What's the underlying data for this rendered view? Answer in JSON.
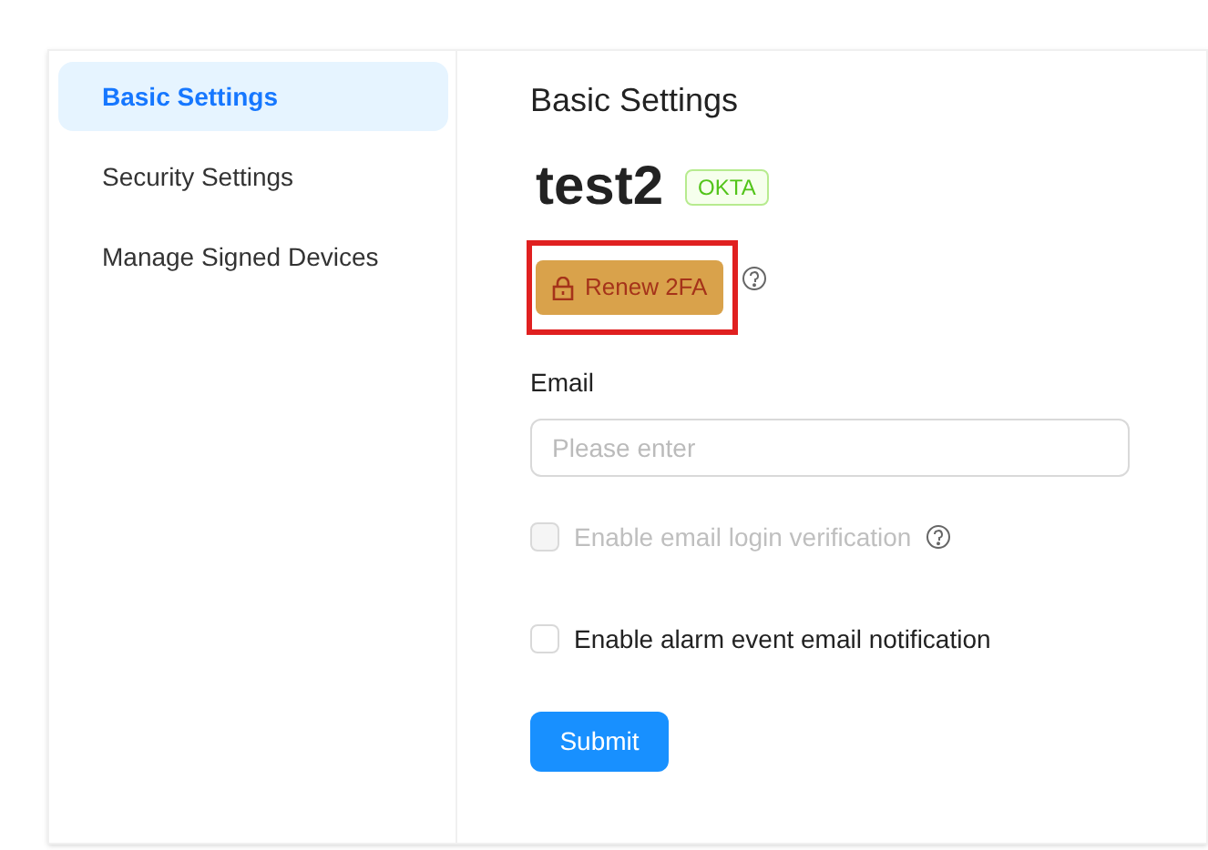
{
  "sidebar": {
    "items": [
      {
        "label": "Basic Settings",
        "selected": true
      },
      {
        "label": "Security Settings",
        "selected": false
      },
      {
        "label": "Manage Signed Devices",
        "selected": false
      }
    ]
  },
  "content": {
    "title": "Basic Settings",
    "username": "test2",
    "tag": "OKTA",
    "renew_button": "Renew 2FA",
    "email": {
      "label": "Email",
      "placeholder": "Please enter"
    },
    "options": [
      {
        "label": "Enable email login verification",
        "checked": false,
        "disabled": true,
        "help": true
      },
      {
        "label": "Enable alarm event email notification",
        "checked": false,
        "disabled": false,
        "help": false
      }
    ],
    "submit": "Submit"
  }
}
